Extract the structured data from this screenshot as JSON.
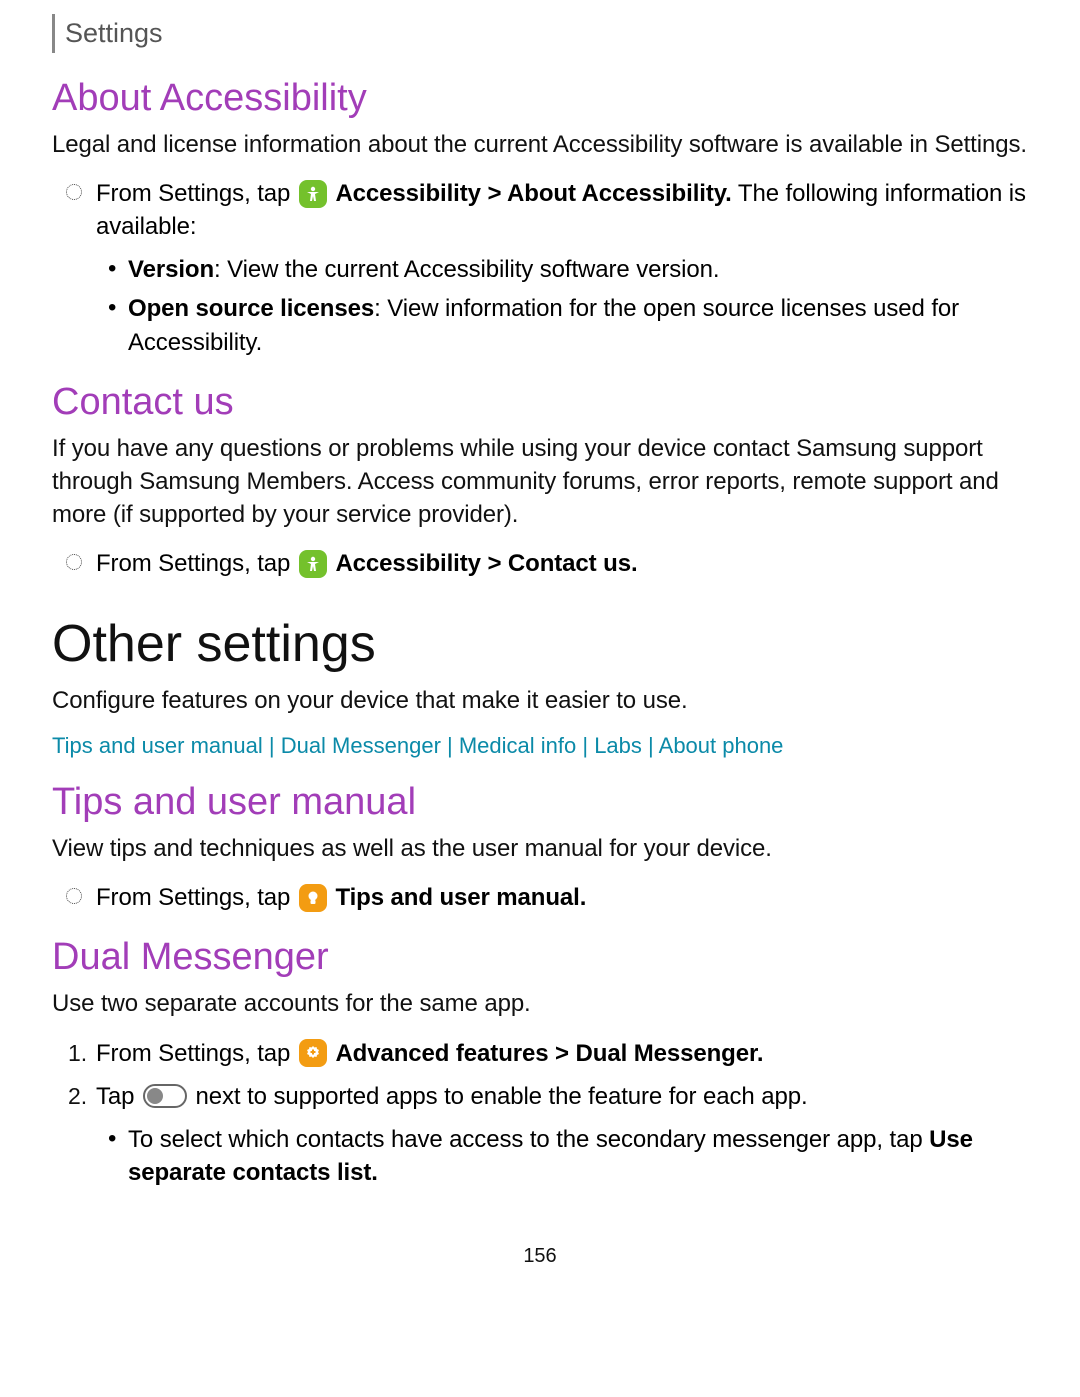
{
  "breadcrumb": "Settings",
  "about": {
    "heading": "About Accessibility",
    "intro": "Legal and license information about the current Accessibility software is available in Settings.",
    "instr_prefix": "From Settings, tap ",
    "instr_bold": "Accessibility > About Accessibility.",
    "instr_suffix": " The following information is available:",
    "bullets": [
      {
        "label": "Version",
        "text": ": View the current Accessibility software version."
      },
      {
        "label": "Open source licenses",
        "text": ": View information for the open source licenses used for Accessibility."
      }
    ]
  },
  "contact": {
    "heading": "Contact us",
    "intro": "If you have any questions or problems while using your device contact Samsung support through Samsung Members. Access community forums, error reports, remote support and more (if supported by your service provider).",
    "instr_prefix": "From Settings, tap ",
    "instr_bold": "Accessibility > Contact us."
  },
  "other": {
    "heading": "Other settings",
    "intro": "Configure features on your device that make it easier to use.",
    "links": [
      "Tips and user manual",
      "Dual Messenger",
      "Medical info",
      "Labs",
      "About phone"
    ],
    "sep": " | "
  },
  "tips": {
    "heading": "Tips and user manual",
    "intro": "View tips and techniques as well as the user manual for your device.",
    "instr_prefix": "From Settings, tap ",
    "instr_bold": "Tips and user manual."
  },
  "dual": {
    "heading": "Dual Messenger",
    "intro": "Use two separate accounts for the same app.",
    "step1_prefix": "From Settings, tap ",
    "step1_bold": "Advanced features > Dual Messenger.",
    "step2_prefix": "Tap ",
    "step2_suffix": " next to supported apps to enable the feature for each app.",
    "sub_prefix": "To select which contacts have access to the secondary messenger app, tap ",
    "sub_bold": "Use separate contacts list."
  },
  "page_number": "156"
}
